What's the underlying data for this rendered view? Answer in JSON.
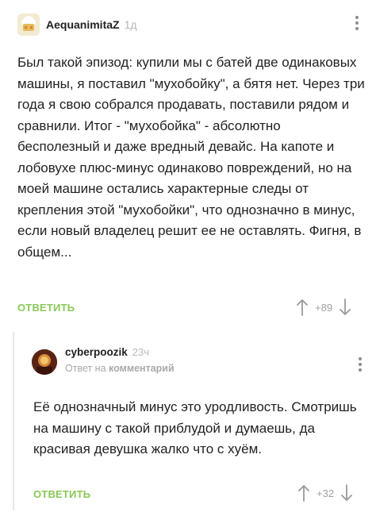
{
  "comment": {
    "author": "AequanimitaZ",
    "time": "1д",
    "text": "Был такой эпизод: купили мы с батей две одинаковых машины, я поставил \"мухобойку\", а бятя нет. Через три года я свою собрался продавать, поставили рядом и сравнили. Итог - \"мухобойка\" - абсолютно бесполезный и даже вредный девайс. На капоте и лобовухе плюс-минус одинаково повреждений, но на моей машине остались характерные следы от крепления этой \"мухобойки\", что однозначно в минус, если новый владелец решит ее не оставлять. Фигня, в общем...",
    "reply_label": "ОТВЕТИТЬ",
    "rating": "+89"
  },
  "reply": {
    "author": "cyberpoozik",
    "time": "23ч",
    "reply_to_prefix": "Ответ на",
    "reply_to_target": "комментарий",
    "text": "Её однозначный минус это уродливость. Смотришь на машину с такой приблудой и думаешь, да красивая девушка жалко что с хуём.",
    "reply_label": "ОТВЕТИТЬ",
    "rating": "+32"
  },
  "colors": {
    "accent_green": "#8ac858",
    "muted_gray": "#a0a0a0",
    "thread_line": "#e6e6e6"
  },
  "icons": [
    "chef-avatar-icon",
    "more-vertical-icon",
    "upvote-arrow-icon",
    "downvote-arrow-icon"
  ]
}
